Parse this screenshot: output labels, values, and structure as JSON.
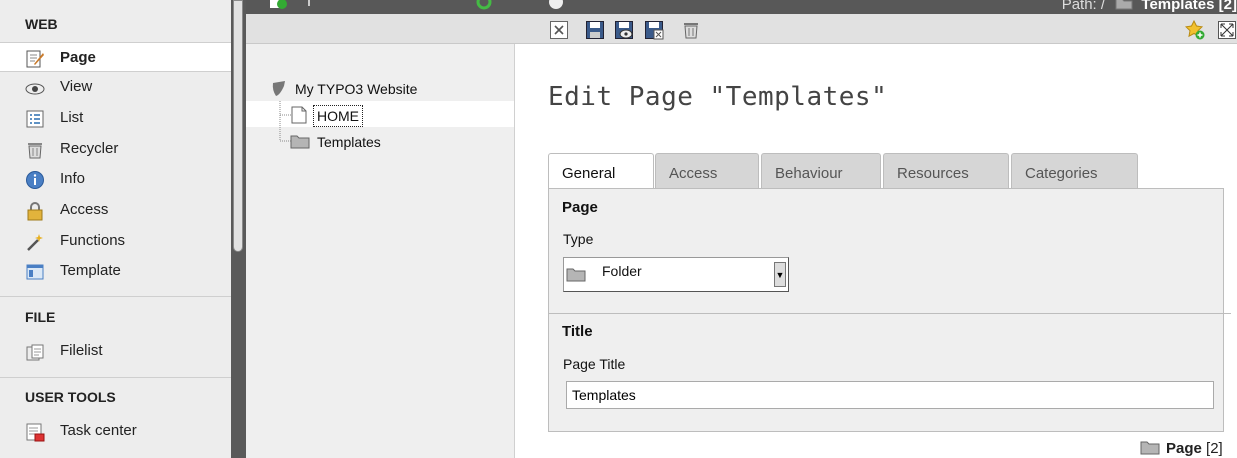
{
  "menu": {
    "web_title": "WEB",
    "web_items": [
      {
        "label": "Page",
        "icon": "page-edit-icon",
        "active": true
      },
      {
        "label": "View",
        "icon": "eye-icon"
      },
      {
        "label": "List",
        "icon": "list-icon"
      },
      {
        "label": "Recycler",
        "icon": "trash-icon"
      },
      {
        "label": "Info",
        "icon": "info-icon"
      },
      {
        "label": "Access",
        "icon": "lock-icon"
      },
      {
        "label": "Functions",
        "icon": "wand-icon"
      },
      {
        "label": "Template",
        "icon": "template-icon"
      }
    ],
    "file_title": "FILE",
    "file_items": [
      {
        "label": "Filelist",
        "icon": "filelist-icon"
      }
    ],
    "user_title": "USER TOOLS",
    "user_items": [
      {
        "label": "Task center",
        "icon": "task-center-icon"
      }
    ]
  },
  "topbar": {
    "path_label": "Path: /",
    "path_current": "Templates [2]"
  },
  "tree": {
    "root": "My TYPO3 Website",
    "children": [
      {
        "label": "HOME"
      },
      {
        "label": "Templates"
      }
    ]
  },
  "content": {
    "title": "Edit Page \"Templates\"",
    "tabs": [
      "General",
      "Access",
      "Behaviour",
      "Resources",
      "Categories"
    ],
    "active_tab": "General",
    "section_page": "Page",
    "type_label": "Type",
    "type_value": "Folder",
    "section_title": "Title",
    "page_title_label": "Page Title",
    "page_title_value": "Templates",
    "footer_label": "Page",
    "footer_id": "[2]"
  },
  "colors": {
    "topbar": "#585858",
    "sidebar": "#ededed",
    "tree": "#efefef"
  }
}
